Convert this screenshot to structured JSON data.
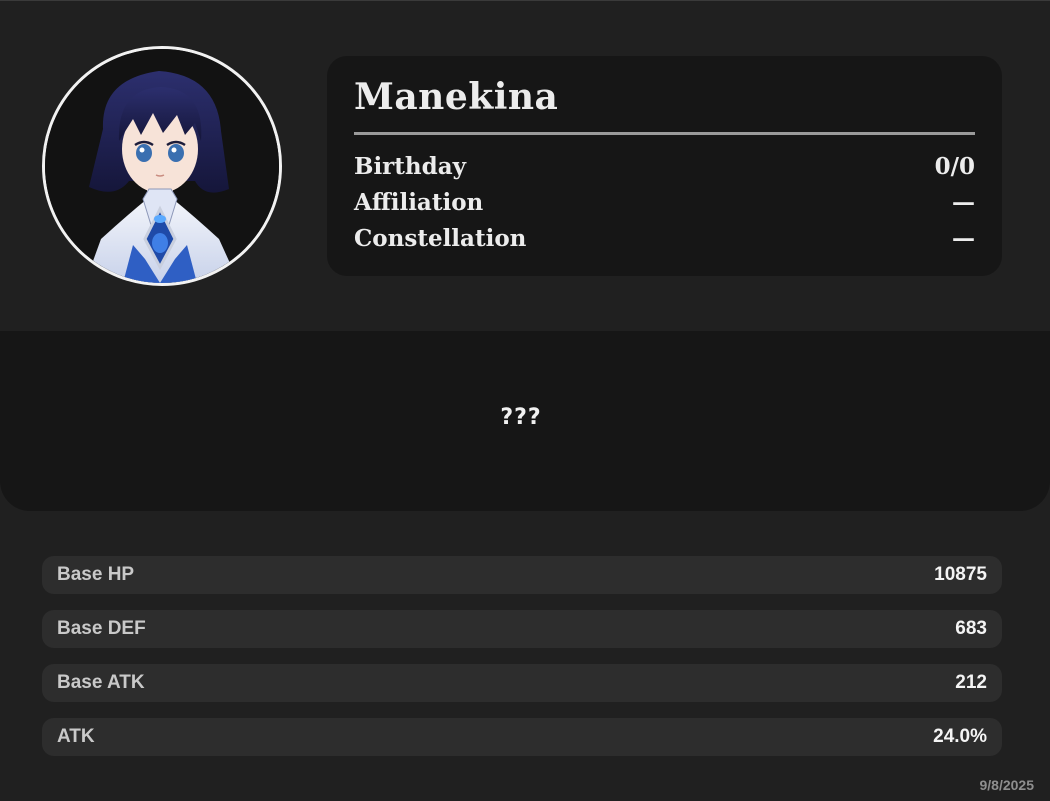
{
  "character": {
    "name": "Manekina",
    "avatar_alt": "character-portrait"
  },
  "info": {
    "rows": [
      {
        "label": "Birthday",
        "value": "0/0"
      },
      {
        "label": "Affiliation",
        "value": "—"
      },
      {
        "label": "Constellation",
        "value": "—"
      }
    ]
  },
  "description": {
    "text": "???"
  },
  "stats": [
    {
      "label": "Base HP",
      "value": "10875"
    },
    {
      "label": "Base DEF",
      "value": "683"
    },
    {
      "label": "Base ATK",
      "value": "212"
    },
    {
      "label": "ATK",
      "value": "24.0%"
    }
  ],
  "footer": {
    "date": "9/8/2025"
  },
  "colors": {
    "background": "#202020",
    "card": "#161616",
    "stat_bar": "#2d2d2d",
    "text": "#ececec",
    "muted": "#8e8e8e"
  }
}
